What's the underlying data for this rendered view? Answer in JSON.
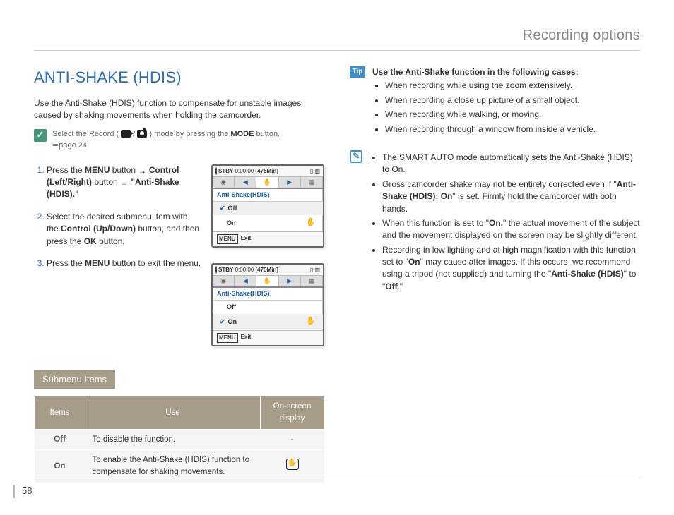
{
  "header": {
    "title": "Recording options"
  },
  "page_number": "58",
  "section": {
    "title": "ANTI-SHAKE (HDIS)",
    "intro": "Use the Anti-Shake (HDIS) function to compensate for unstable images caused by shaking movements when holding the camcorder."
  },
  "prereq": {
    "line_a": "Select the Record ( ",
    "line_b": " / ",
    "line_c": " ) mode by pressing the ",
    "mode_btn": "MODE",
    "line_d": " button.",
    "ref": "➥page 24"
  },
  "steps": [
    {
      "pre": "Press the ",
      "b1": "MENU",
      "mid1": " button ",
      "arrow1": "→",
      "mid2": " ",
      "b2": "Control (Left/Right)",
      "mid3": " button ",
      "arrow2": "→",
      "mid4": " ",
      "b3": "\"Anti-Shake (HDIS).\""
    },
    {
      "pre": "Select the desired submenu item with the ",
      "b1": "Control (Up/Down)",
      "mid1": " button, and then press the ",
      "b2": "OK",
      "mid2": " button."
    },
    {
      "pre": "Press the ",
      "b1": "MENU",
      "mid1": " button to exit the menu."
    }
  ],
  "lcd": {
    "stby": "STBY",
    "counter": "0:00:00",
    "remain": "[475Min]",
    "label_a": "Anti-Shake",
    "label_b": "(HDIS)",
    "off": "Off",
    "on": "On",
    "menu": "MENU",
    "exit": "Exit"
  },
  "submenu_heading": "Submenu Items",
  "table": {
    "h1": "Items",
    "h2": "Use",
    "h3": "On-screen display",
    "rows": [
      {
        "item": "Off",
        "use": "To disable the function.",
        "disp": "-"
      },
      {
        "item": "On",
        "use": "To enable the Anti-Shake (HDIS) function to compensate for shaking movements.",
        "disp": "hand"
      }
    ]
  },
  "tip": {
    "heading": "Use the Anti-Shake function in the following cases:",
    "items": [
      "When recording while using the zoom extensively.",
      "When recording a close up picture of a small object.",
      "When recording while walking, or moving.",
      "When recording through a window from inside a vehicle."
    ]
  },
  "notes": [
    {
      "t1": "The SMART AUTO mode automatically sets the Anti-Shake (HDIS) to On."
    },
    {
      "t1": "Gross camcorder shake may not be entirely corrected even if \"",
      "b1": "Anti-Shake (HDIS): On",
      "t2": "\" is set. Firmly hold the camcorder with both hands."
    },
    {
      "t1": "When this function is set to \"",
      "b1": "On,",
      "t2": "\" the actual movement of the subject and the movement displayed on the screen may be slightly different."
    },
    {
      "t1": "Recording in low lighting and at high magnification with this function set to \"",
      "b1": "On",
      "t2": "\" may cause after images. If this occurs, we recommend using a tripod (not supplied) and turning the \"",
      "b2": "Anti-Shake (HDIS)",
      "t3": "\" to \"",
      "b3": "Off",
      "t4": ".\""
    }
  ]
}
